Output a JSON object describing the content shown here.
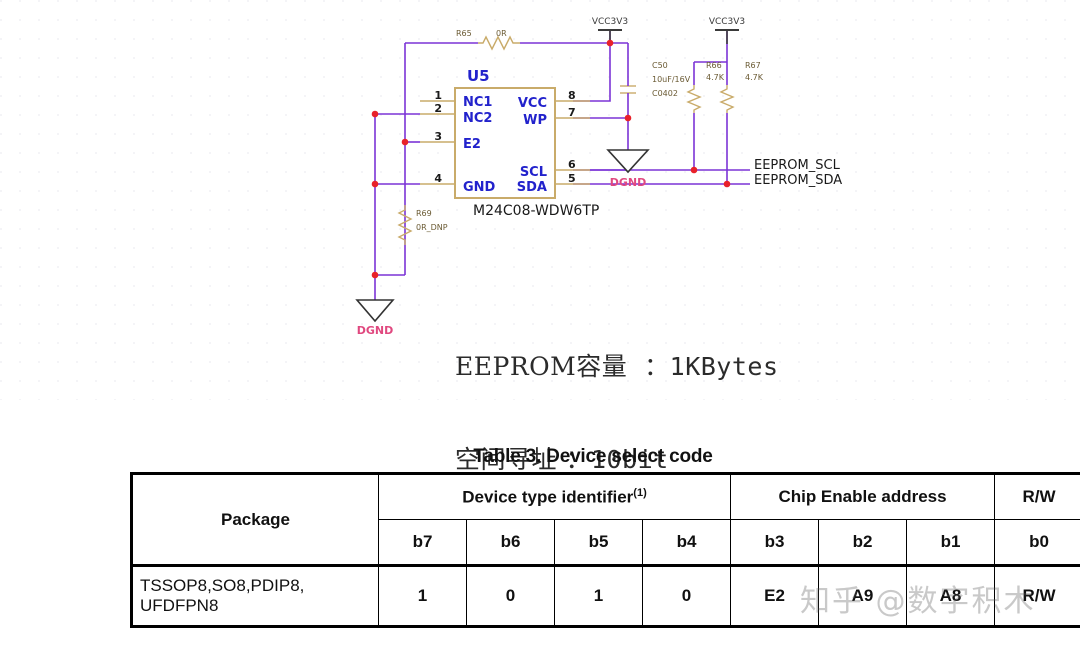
{
  "schematic": {
    "designator": "U5",
    "part_number": "M24C08-WDW6TP",
    "pins_left": [
      {
        "num": "1",
        "name": "NC1"
      },
      {
        "num": "2",
        "name": "NC2"
      },
      {
        "num": "3",
        "name": "E2"
      },
      {
        "num": "4",
        "name": "GND"
      }
    ],
    "pins_right": [
      {
        "num": "8",
        "name": "VCC"
      },
      {
        "num": "7",
        "name": "WP"
      },
      {
        "num": "6",
        "name": "SCL"
      },
      {
        "num": "5",
        "name": "SDA"
      }
    ],
    "components": [
      {
        "designator": "R65",
        "value": "0R"
      },
      {
        "designator": "R69",
        "value": "0R_DNP"
      },
      {
        "designator": "R66",
        "value": "4.7K"
      },
      {
        "designator": "R67",
        "value": "4.7K"
      },
      {
        "designator": "C50",
        "value": "10uF/16V",
        "footprint": "C0402"
      }
    ],
    "power_labels": [
      "VCC3V3",
      "VCC3V3"
    ],
    "ground_labels": [
      "DGND",
      "DGND"
    ],
    "net_labels": [
      "EEPROM_SCL",
      "EEPROM_SDA"
    ],
    "colors": {
      "wire": "#7b33d6",
      "pin": "#c9ab6a",
      "pin_text": "#2222cc",
      "junction": "#e8212a",
      "ground_text": "#e0487f"
    }
  },
  "annotation": {
    "line1_label": "EEPROM容量  ：",
    "line1_value": "1KBytes",
    "line2_label": "空间寻址 ：",
    "line2_value": "10bit"
  },
  "table": {
    "title": "Table 3. Device select code",
    "group_headers": {
      "package": "Package",
      "device_type": "Device type identifier",
      "device_type_note": "(1)",
      "chip_enable": "Chip Enable address",
      "rw": "R/W"
    },
    "bit_headers": [
      "b7",
      "b6",
      "b5",
      "b4",
      "b3",
      "b2",
      "b1",
      "b0"
    ],
    "rows": [
      {
        "package": "TSSOP8,SO8,PDIP8, UFDFPN8",
        "package_line1": "TSSOP8,SO8,PDIP8,",
        "package_line2": "UFDFPN8",
        "bits": [
          "1",
          "0",
          "1",
          "0",
          "E2",
          "A9",
          "A8",
          "R/W"
        ]
      }
    ]
  },
  "watermark": {
    "text": "知乎 @数字积木"
  }
}
